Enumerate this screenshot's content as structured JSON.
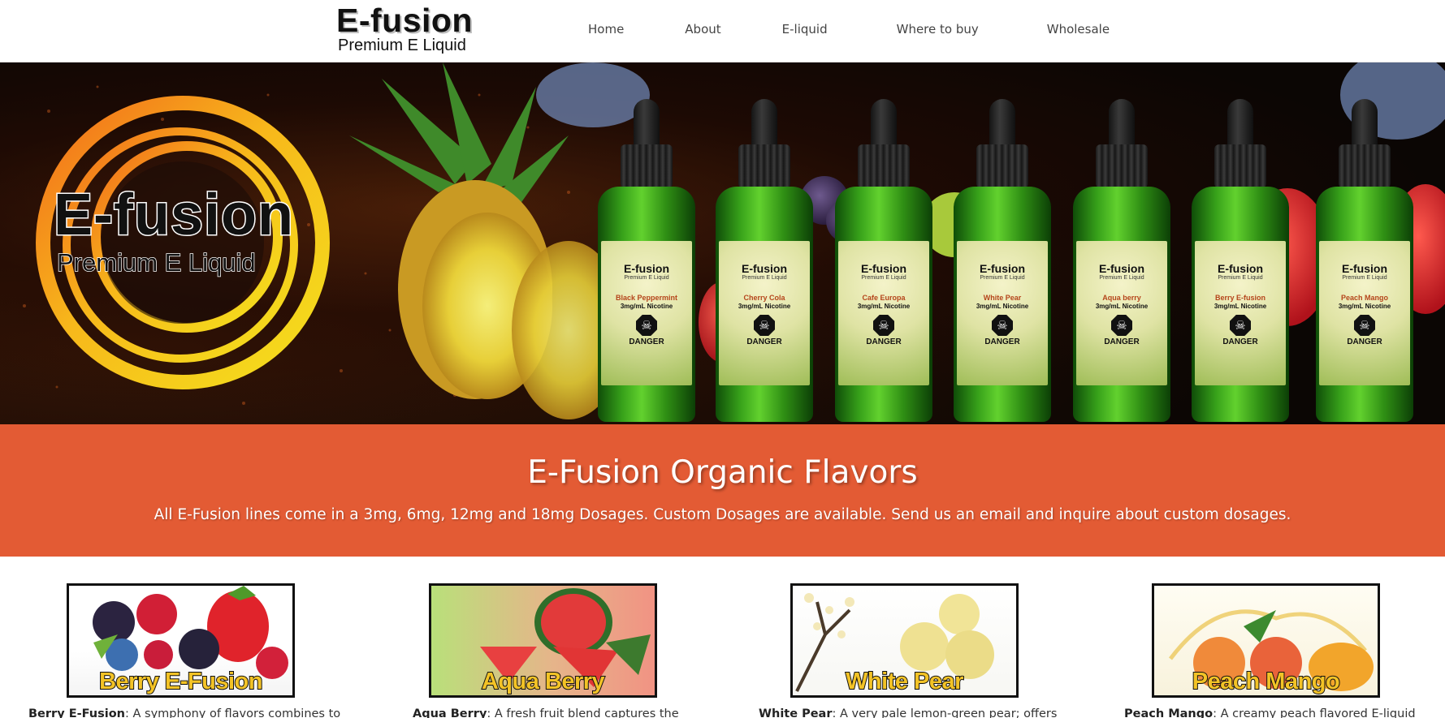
{
  "header": {
    "logo_title": "E-fusion",
    "logo_subtitle": "Premium E Liquid",
    "nav": [
      "Home",
      "About",
      "E-liquid",
      "Where to buy",
      "Wholesale"
    ]
  },
  "hero": {
    "logo_title": "E-fusion",
    "logo_subtitle": "Premium E Liquid",
    "bottles": [
      {
        "brand": "E-fusion",
        "sub": "Premium E Liquid",
        "flavor": "Black Peppermint",
        "nicotine": "3mg/mL Nicotine",
        "warning": "DANGER"
      },
      {
        "brand": "E-fusion",
        "sub": "Premium E Liquid",
        "flavor": "Cherry Cola",
        "nicotine": "3mg/mL Nicotine",
        "warning": "DANGER"
      },
      {
        "brand": "E-fusion",
        "sub": "Premium E Liquid",
        "flavor": "Cafe Europa",
        "nicotine": "3mg/mL Nicotine",
        "warning": "DANGER"
      },
      {
        "brand": "E-fusion",
        "sub": "Premium E Liquid",
        "flavor": "White Pear",
        "nicotine": "3mg/mL Nicotine",
        "warning": "DANGER"
      },
      {
        "brand": "E-fusion",
        "sub": "Premium E Liquid",
        "flavor": "Aqua berry",
        "nicotine": "3mg/mL Nicotine",
        "warning": "DANGER"
      },
      {
        "brand": "E-fusion",
        "sub": "Premium E Liquid",
        "flavor": "Berry E-fusion",
        "nicotine": "3mg/mL Nicotine",
        "warning": "DANGER"
      },
      {
        "brand": "E-fusion",
        "sub": "Premium E Liquid",
        "flavor": "Peach Mango",
        "nicotine": "3mg/mL Nicotine",
        "warning": "DANGER"
      }
    ]
  },
  "banner": {
    "title": "E-Fusion Organic Flavors",
    "text": "All E-Fusion lines come in a 3mg, 6mg, 12mg and 18mg Dosages. Custom Dosages are available. Send us an email and inquire about custom dosages."
  },
  "products": [
    {
      "image_label": "Berry E-Fusion",
      "name": "Berry E-Fusion",
      "desc": ": A symphony of flavors combines to"
    },
    {
      "image_label": "Aqua Berry",
      "name": "Aqua Berry",
      "desc": ": A fresh fruit blend captures the"
    },
    {
      "image_label": "White Pear",
      "name": "White Pear",
      "desc": ": A very pale lemon-green pear; offers"
    },
    {
      "image_label": "Peach Mango",
      "name": "Peach Mango",
      "desc": ": A creamy peach flavored E-liquid"
    }
  ],
  "colors": {
    "banner": "#e35b34",
    "ring_outer": "#f7a21b",
    "ring_inner": "#f4d21c",
    "bottle_glass": "#2f8f14",
    "product_label": "#f3c326"
  },
  "icons": [
    "danger-skull-icon"
  ]
}
